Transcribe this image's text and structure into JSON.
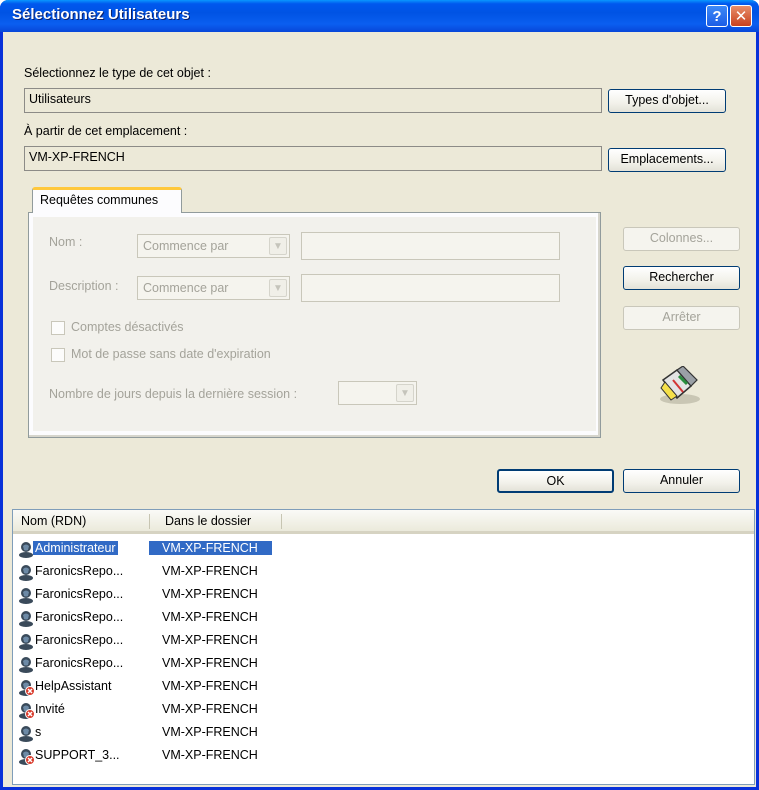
{
  "window": {
    "title": "Sélectionnez Utilisateurs",
    "help_glyph": "?",
    "close_glyph": "✕"
  },
  "object_type": {
    "label": "Sélectionnez le type de cet objet :",
    "value": "Utilisateurs",
    "button": "Types d'objet..."
  },
  "location": {
    "label": "À partir de cet emplacement :",
    "value": "VM-XP-FRENCH",
    "button": "Emplacements..."
  },
  "tab": {
    "label": "Requêtes communes",
    "name_label": "Nom :",
    "name_combo": "Commence par",
    "desc_label": "Description :",
    "desc_combo": "Commence par",
    "disabled_accounts": "Comptes désactivés",
    "no_expiry": "Mot de passe sans date d'expiration",
    "days_label": "Nombre de jours depuis la dernière session :"
  },
  "side_buttons": {
    "columns": "Colonnes...",
    "search": "Rechercher",
    "stop": "Arrêter"
  },
  "footer": {
    "ok": "OK",
    "cancel": "Annuler"
  },
  "results": {
    "columns": [
      "Nom (RDN)",
      "Dans le dossier"
    ],
    "rows": [
      {
        "name": "Administrateur",
        "folder": "VM-XP-FRENCH",
        "selected": true,
        "disabled": false
      },
      {
        "name": "FaronicsRepo...",
        "folder": "VM-XP-FRENCH",
        "selected": false,
        "disabled": false
      },
      {
        "name": "FaronicsRepo...",
        "folder": "VM-XP-FRENCH",
        "selected": false,
        "disabled": false
      },
      {
        "name": "FaronicsRepo...",
        "folder": "VM-XP-FRENCH",
        "selected": false,
        "disabled": false
      },
      {
        "name": "FaronicsRepo...",
        "folder": "VM-XP-FRENCH",
        "selected": false,
        "disabled": false
      },
      {
        "name": "FaronicsRepo...",
        "folder": "VM-XP-FRENCH",
        "selected": false,
        "disabled": false
      },
      {
        "name": "HelpAssistant",
        "folder": "VM-XP-FRENCH",
        "selected": false,
        "disabled": true
      },
      {
        "name": "Invité",
        "folder": "VM-XP-FRENCH",
        "selected": false,
        "disabled": true
      },
      {
        "name": "s",
        "folder": "VM-XP-FRENCH",
        "selected": false,
        "disabled": false
      },
      {
        "name": "SUPPORT_3...",
        "folder": "VM-XP-FRENCH",
        "selected": false,
        "disabled": true
      }
    ]
  },
  "icons": {
    "search": "search-flashlight-icon",
    "user": "user-icon",
    "disabled_user": "disabled-user-icon"
  },
  "colors": {
    "title_blue": "#0058ee",
    "selection": "#316ac5",
    "tab_accent": "#ffc83c",
    "close_red": "#d34a26"
  }
}
